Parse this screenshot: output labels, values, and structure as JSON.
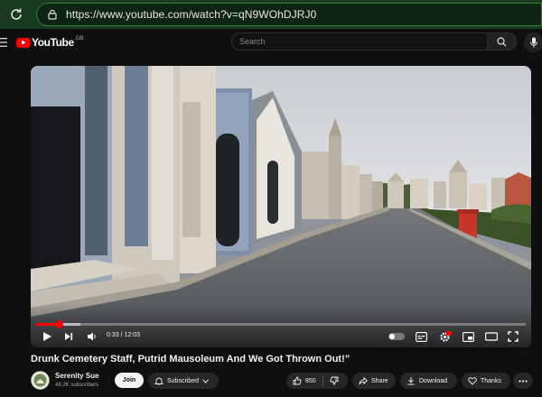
{
  "browser": {
    "url": "https://www.youtube.com/watch?v=qN9WOhDJRJ0"
  },
  "header": {
    "logo_text": "YouTube",
    "region": "GB",
    "search_placeholder": "Search"
  },
  "player": {
    "current_time": "0:33",
    "duration": "12:03",
    "time_display": "0:33 / 12:03",
    "progress_fraction": 0.046,
    "buffered_fraction": 0.09,
    "accent": "#ff0000"
  },
  "video": {
    "title": "Drunk Cemetery Staff, Putrid Mausoleum And We Got Thrown Out!”"
  },
  "channel": {
    "name": "Serenity Sue",
    "subscribers": "49.2K subscribers",
    "join_label": "Join",
    "subscribed_label": "Subscribed"
  },
  "actions": {
    "likes": "850",
    "share_label": "Share",
    "download_label": "Download",
    "thanks_label": "Thanks"
  },
  "icons": [
    "reload-icon",
    "lock-icon",
    "menu-icon",
    "search-icon",
    "mic-icon",
    "play-icon",
    "next-icon",
    "volume-icon",
    "subtitles-icon",
    "settings-icon",
    "miniplayer-icon",
    "theater-icon",
    "fullscreen-icon",
    "bell-icon",
    "chevron-down-icon",
    "like-icon",
    "dislike-icon",
    "share-icon",
    "download-icon",
    "thanks-icon",
    "more-icon"
  ]
}
